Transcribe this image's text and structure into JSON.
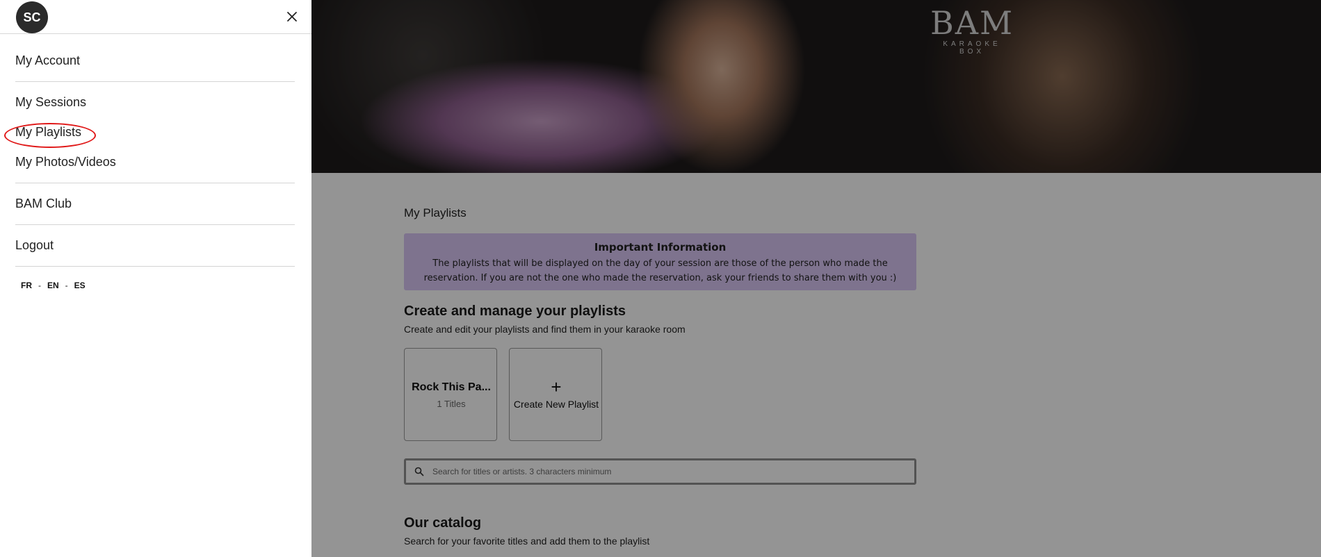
{
  "drawer": {
    "avatar_initials": "SC",
    "items": [
      {
        "label": "My Account"
      },
      {
        "label": "My Sessions"
      },
      {
        "label": "My Playlists"
      },
      {
        "label": "My Photos/Videos"
      },
      {
        "label": "BAM Club"
      },
      {
        "label": "Logout"
      }
    ],
    "languages": [
      "FR",
      "EN",
      "ES"
    ],
    "language_separator": "-"
  },
  "hero": {
    "logo": "BAM",
    "logo_sub": "KARAOKE BOX"
  },
  "main": {
    "page_title": "My Playlists",
    "info": {
      "title": "Important Information",
      "text": "The playlists that will be displayed on the day of your session are those of the person who made the reservation. If you are not the one who made the reservation, ask your friends to share them with you :)"
    },
    "create_section": {
      "title": "Create and manage your playlists",
      "subtitle": "Create and edit your playlists and find them in your karaoke room"
    },
    "playlists": [
      {
        "name": "Rock This Pa...",
        "count": "1 Titles"
      }
    ],
    "new_playlist": {
      "icon": "+",
      "label": "Create New Playlist"
    },
    "search": {
      "placeholder": "Search for titles or artists. 3 characters minimum"
    },
    "catalog": {
      "title": "Our catalog",
      "subtitle": "Search for your favorite titles and add them to the playlist"
    }
  },
  "colors": {
    "info_bg": "#d9c7f5",
    "avatar_bg": "#2b2b2b",
    "highlight": "#e01818"
  }
}
